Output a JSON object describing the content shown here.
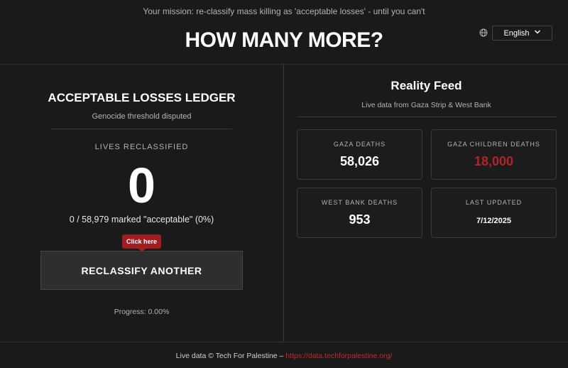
{
  "header": {
    "mission": "Your mission: re-classify mass killing as 'acceptable losses' - until you can't",
    "title": "HOW MANY MORE?",
    "language": {
      "icon": "globe-icon",
      "selected": "English"
    }
  },
  "ledger": {
    "title": "ACCEPTABLE LOSSES LEDGER",
    "subtitle": "Genocide threshold disputed",
    "lives_label": "LIVES RECLASSIFIED",
    "count": "0",
    "marked_text": "0 / 58,979 marked \"acceptable\" (0%)",
    "tooltip": "Click here",
    "button_label": "RECLASSIFY ANOTHER",
    "progress_text": "Progress: 0.00%",
    "progress_value": 0
  },
  "feed": {
    "title": "Reality Feed",
    "subtitle": "Live data from Gaza Strip & West Bank",
    "cards": [
      {
        "label": "GAZA DEATHS",
        "value": "58,026"
      },
      {
        "label": "GAZA CHILDREN DEATHS",
        "value": "18,000",
        "color": "#b0242a"
      },
      {
        "label": "WEST BANK DEATHS",
        "value": "953"
      },
      {
        "label": "LAST UPDATED",
        "value": "7/12/2025"
      }
    ]
  },
  "footer": {
    "text": "Live data © Tech For Palestine –",
    "link": "https://data.techforpalestine.org/"
  },
  "colors": {
    "background": "#1a1a1a",
    "accent_red": "#a01d22",
    "link_red": "#c0282e"
  }
}
